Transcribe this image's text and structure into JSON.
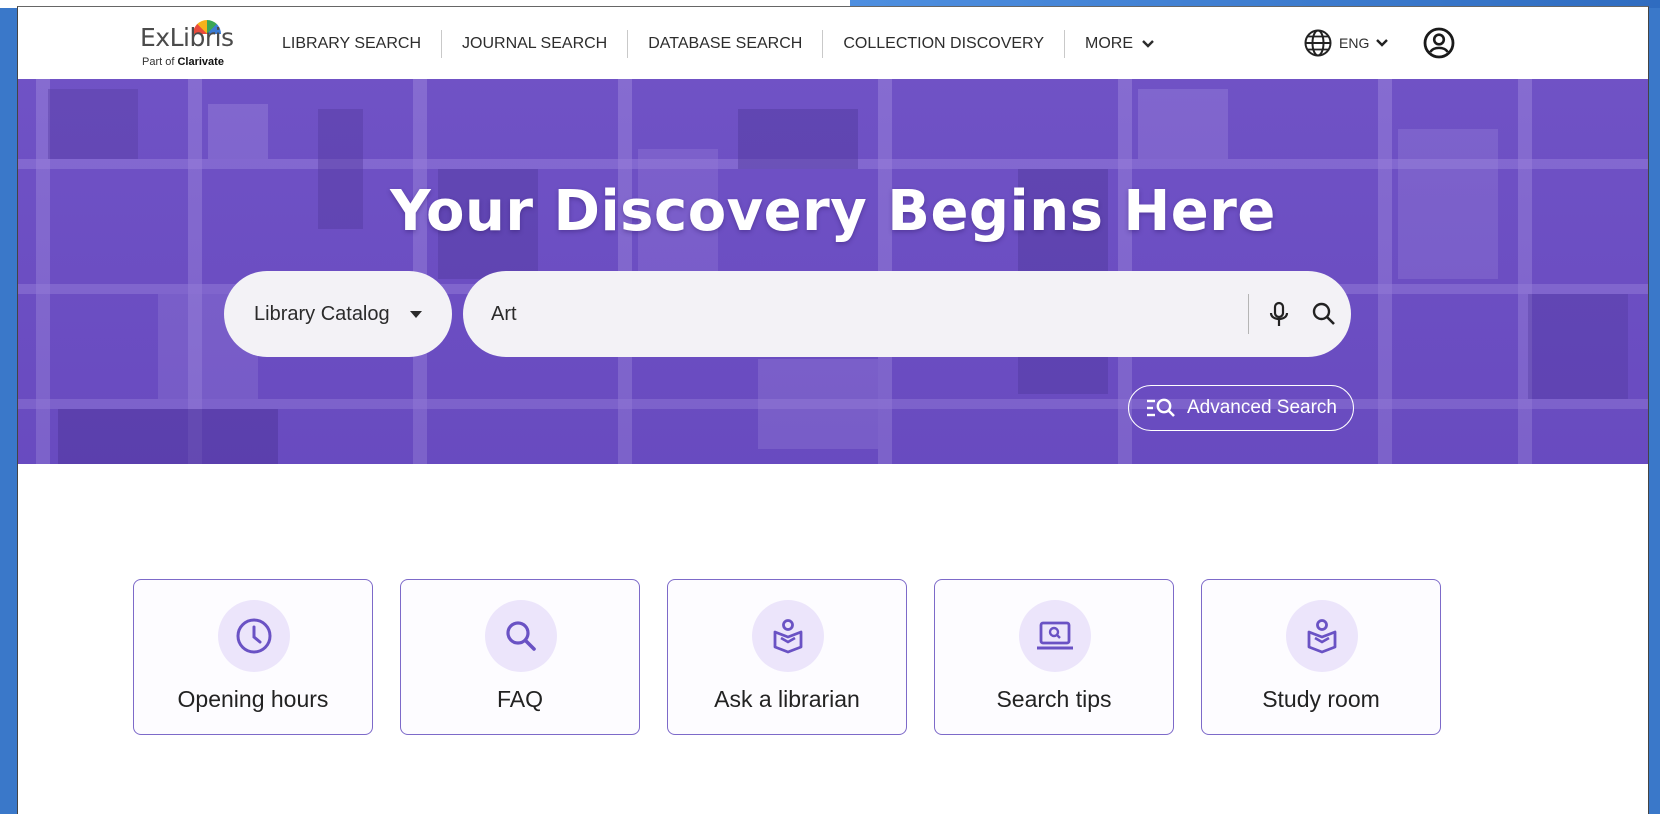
{
  "header": {
    "logo_text": "ExLibris",
    "logo_sub_prefix": "Part of ",
    "logo_sub_brand": "Clarivate",
    "nav": [
      {
        "label": "LIBRARY SEARCH"
      },
      {
        "label": "JOURNAL SEARCH"
      },
      {
        "label": "DATABASE SEARCH"
      },
      {
        "label": "COLLECTION DISCOVERY"
      },
      {
        "label": "MORE"
      }
    ],
    "language": "ENG",
    "icons": {
      "more": "chevron-down-icon",
      "language": "globe-icon",
      "user": "user-account-icon"
    }
  },
  "hero": {
    "title": "Your Discovery Begins Here",
    "scope_label": "Library Catalog",
    "search_value": "Art",
    "advanced_search_label": "Advanced Search",
    "colors": {
      "overlay": "#6f52c2",
      "accent": "#7d6ac9"
    }
  },
  "tiles": [
    {
      "label": "Opening hours",
      "icon": "clock-icon"
    },
    {
      "label": "FAQ",
      "icon": "search-icon"
    },
    {
      "label": "Ask a librarian",
      "icon": "reader-icon"
    },
    {
      "label": "Search tips",
      "icon": "laptop-search-icon"
    },
    {
      "label": "Study room",
      "icon": "reader-icon"
    }
  ]
}
